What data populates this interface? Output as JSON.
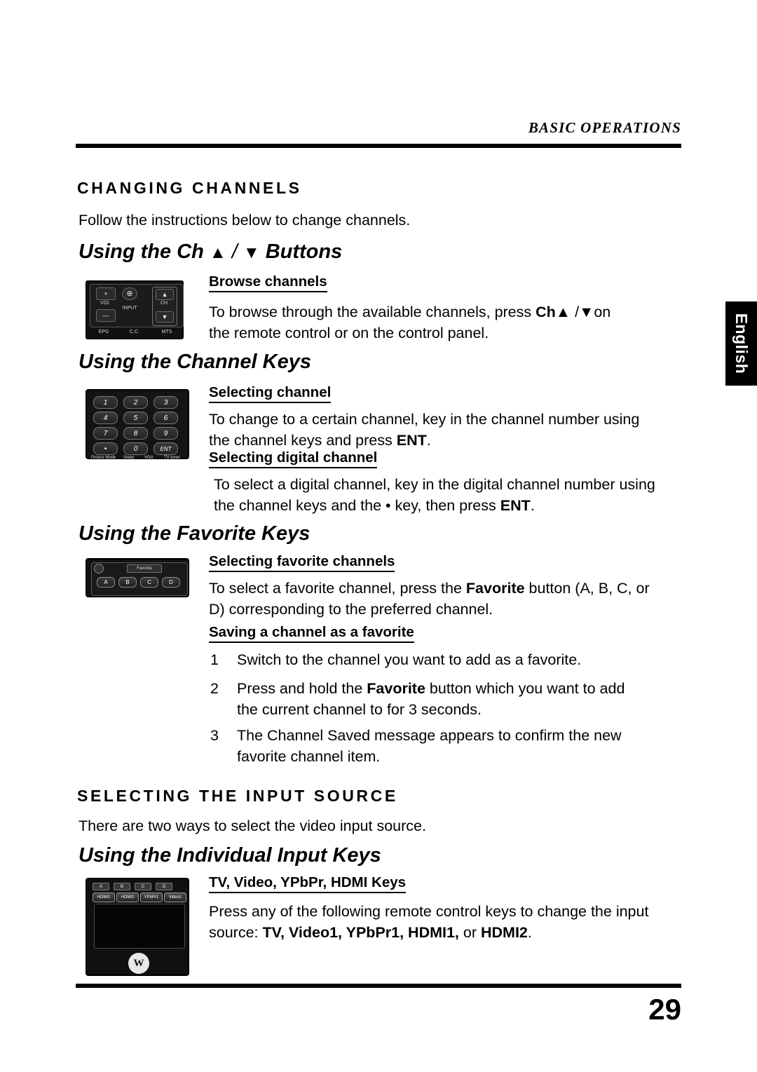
{
  "header": {
    "running_title": "BASIC OPERATIONS",
    "language_tab": "English"
  },
  "footer": {
    "page_number": "29"
  },
  "sections": [
    {
      "heading": "CHANGING CHANNELS",
      "intro": "Follow the instructions below to change channels."
    },
    {
      "heading": "SELECTING THE INPUT SOURCE",
      "intro": "There are two ways to select the video input source."
    }
  ],
  "subsections": {
    "ch_buttons_title_pre": "Using the Ch",
    "ch_buttons_title_sep": "/",
    "ch_buttons_title_post": "Buttons",
    "channel_keys_title": "Using the Channel Keys",
    "favorite_keys_title": "Using the Favorite Keys",
    "individual_input_title": "Using the Individual Input Keys"
  },
  "topics": {
    "browse_channels": {
      "title": "Browse channels",
      "line1_a": "To browse through the available channels, press",
      "line1_b": "Ch",
      "line1_sep": "/",
      "line1_c": "on",
      "line2": "the remote control or on the control panel."
    },
    "selecting_channel": {
      "title": "Selecting channel",
      "line1": "To change to a certain channel, key in the channel number using",
      "line2_a": "the channel keys and press",
      "line2_b": "ENT",
      "line2_c": "."
    },
    "selecting_digital_channel": {
      "title": "Selecting digital channel",
      "line1": "To select a digital channel, key in the digital channel number using",
      "line2_a": "the channel keys and the • key, then press",
      "line2_b": "ENT",
      "line2_c": "."
    },
    "selecting_favorite_channels": {
      "title": "Selecting favorite channels",
      "line1_a": "To select a favorite channel, press the",
      "line1_b": "Favorite",
      "line1_c": "button (A, B, C, or",
      "line2": "D) corresponding to the preferred channel."
    },
    "saving_a_channel_as_a_favorite": {
      "title": "Saving a channel as a favorite",
      "steps": [
        {
          "n": "1",
          "text": "Switch to the channel you want to add as a favorite."
        },
        {
          "n": "2",
          "text_a": "Press and hold the",
          "text_b": "Favorite",
          "text_c": "button which you want to add",
          "text_d": "the current channel to for 3 seconds."
        },
        {
          "n": "3",
          "text_a": "The Channel Saved message appears to confirm the new",
          "text_d": "favorite channel item."
        }
      ]
    },
    "input_keys": {
      "title": "TV,  Video, YPbPr, HDMI Keys",
      "line1": "Press any of the following remote control keys to change the input",
      "line2_a": "source:",
      "line2_b": "TV,  Video1, YPbPr1, HDMI1,",
      "line2_c": "or",
      "line2_d": "HDMI2",
      "line2_e": "."
    }
  },
  "graphics": {
    "remote_vol_ch": {
      "name": "control-panel-vol-ch",
      "vol_label": "VOL",
      "ch_label": "CH",
      "plus": "+",
      "minus": "—",
      "input_label": "INPUT",
      "bottom_labels": [
        "EPG",
        "C.C.",
        "MTS"
      ]
    },
    "remote_keypad": {
      "name": "remote-numeric-keypad",
      "keys": [
        "1",
        "2",
        "3",
        "4",
        "5",
        "6",
        "7",
        "8",
        "9",
        "•",
        "0",
        "ENT"
      ],
      "bottom_labels": [
        "Picture Mode",
        "Sleep",
        "VGA",
        "TV tuner"
      ]
    },
    "remote_favorite": {
      "name": "remote-favorite-keys",
      "title": "Favorite",
      "keys": [
        "A",
        "B",
        "C",
        "D"
      ]
    },
    "remote_input": {
      "name": "remote-input-keys",
      "top_keys": [
        "A",
        "B",
        "C",
        "D"
      ],
      "input_keys": [
        "HDMI1",
        "HDMI2",
        "YPbPr1",
        "Video1"
      ],
      "brand_mark": "W"
    }
  }
}
